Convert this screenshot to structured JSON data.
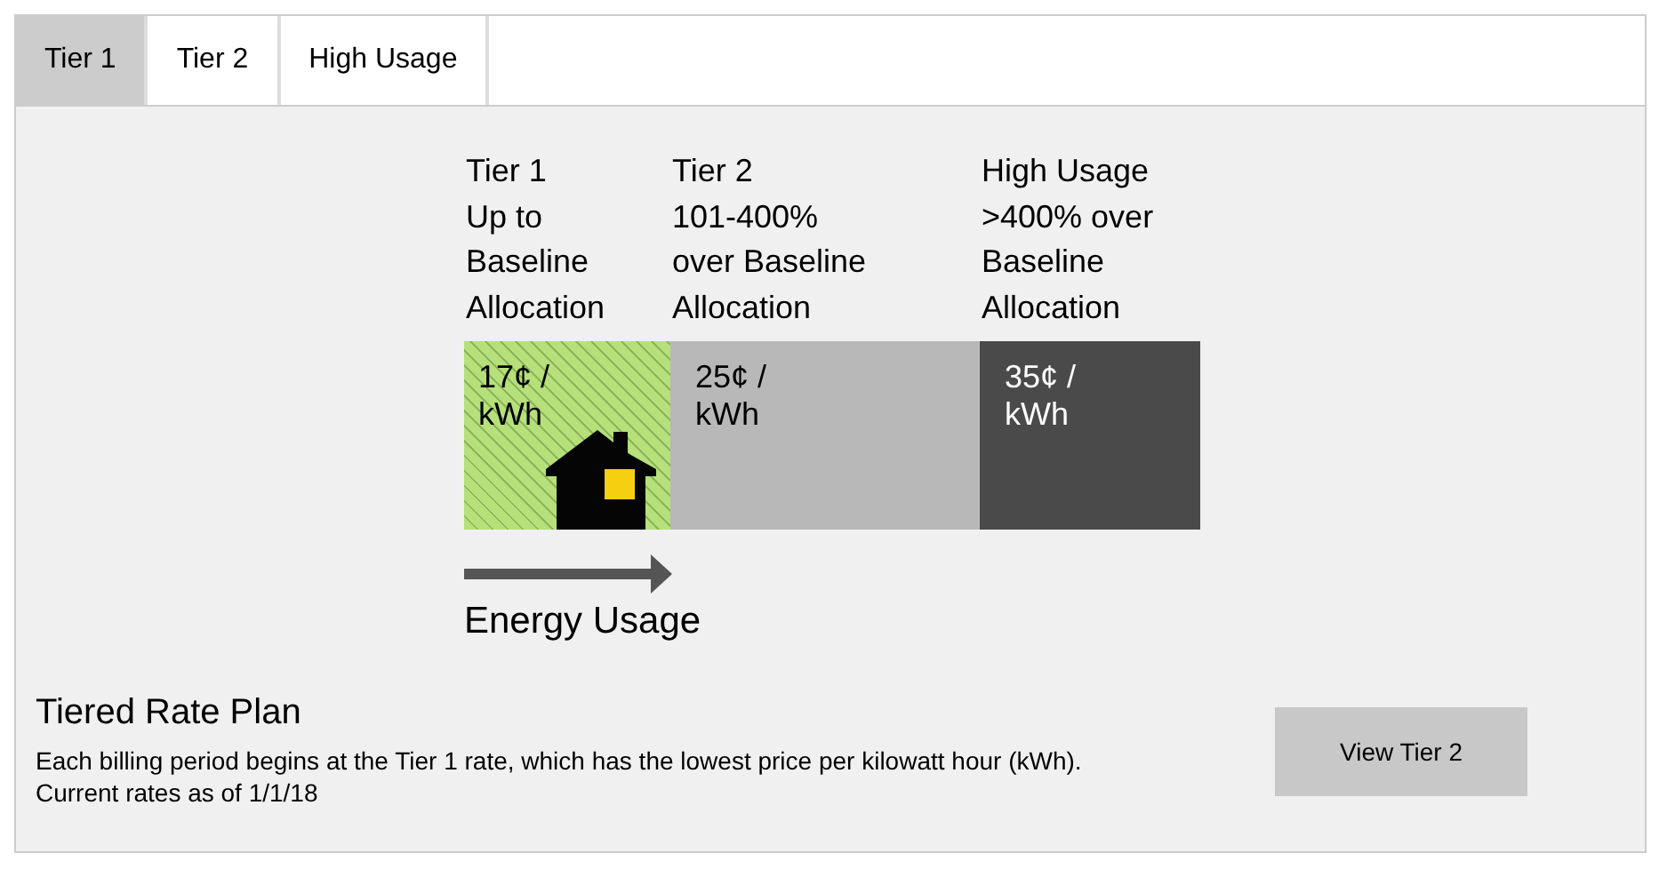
{
  "tabs": [
    {
      "label": "Tier 1",
      "selected": true
    },
    {
      "label": "Tier 2",
      "selected": false
    },
    {
      "label": "High Usage",
      "selected": false
    }
  ],
  "tiers": [
    {
      "name": "Tier 1",
      "description_lines": [
        "Up to",
        "Baseline",
        "Allocation"
      ],
      "price": "17¢ / kWh",
      "kind": "hatched",
      "house": true
    },
    {
      "name": "Tier 2",
      "description_lines": [
        "101-400%",
        "over Baseline",
        "Allocation"
      ],
      "price": "25¢ / kWh",
      "kind": "light",
      "house": false
    },
    {
      "name": "High Usage",
      "description_lines": [
        ">400% over",
        "Baseline",
        "Allocation"
      ],
      "price": "35¢ / kWh",
      "kind": "dark",
      "house": false
    }
  ],
  "axis_label": "Energy Usage",
  "plan": {
    "title": "Tiered Rate Plan",
    "description": "Each billing period begins at the Tier 1 rate, which has the lowest price per kilowatt hour (kWh).",
    "note": "Current rates as of 1/1/18",
    "button": "View Tier 2"
  }
}
